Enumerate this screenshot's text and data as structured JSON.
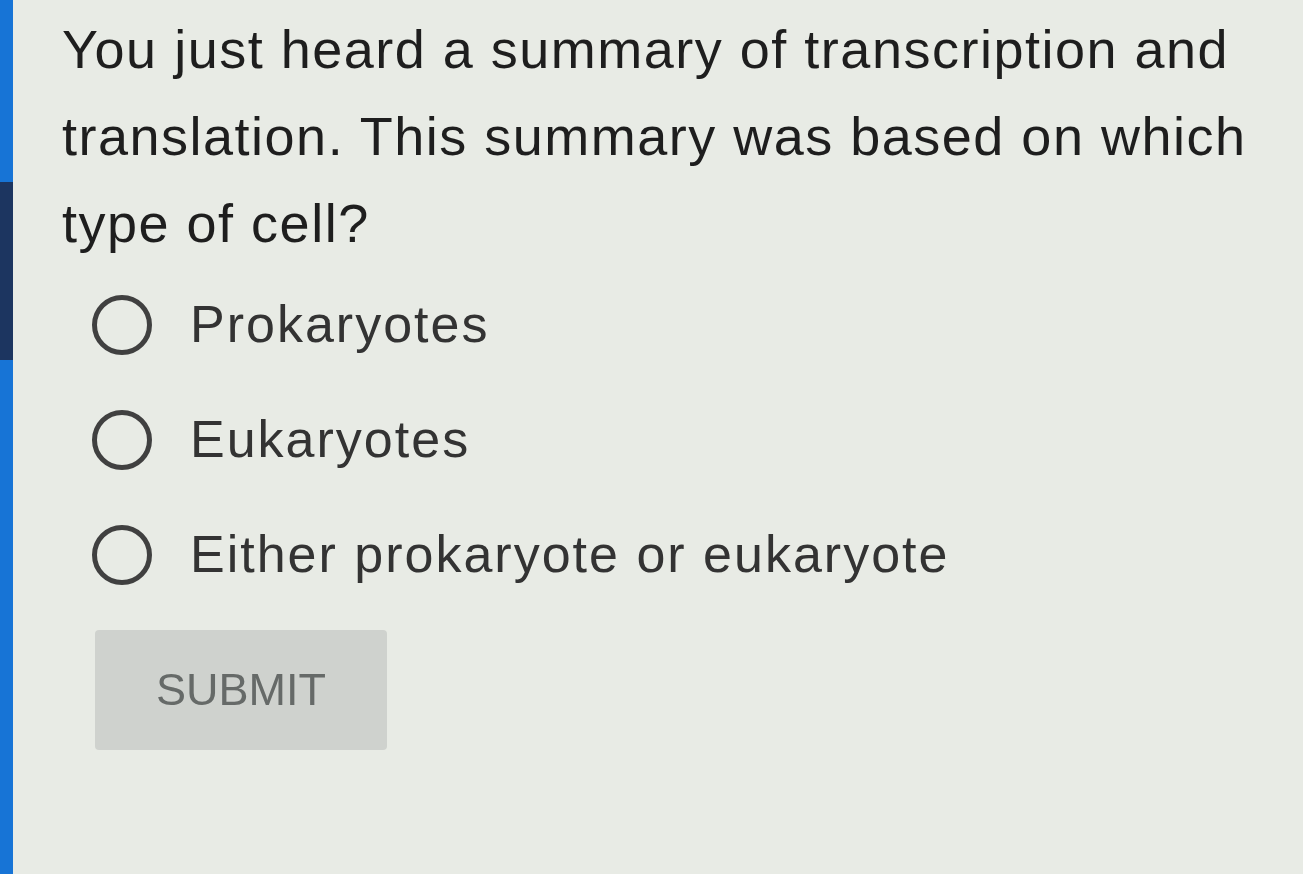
{
  "question": "You just heard a summary of transcription and translation. This summary was based on which type of cell?",
  "options": [
    {
      "label": "Prokaryotes",
      "selected": false
    },
    {
      "label": "Eukaryotes",
      "selected": false
    },
    {
      "label": "Either prokaryote or eukaryote",
      "selected": false
    }
  ],
  "submit": {
    "label": "SUBMIT",
    "disabled": true
  }
}
